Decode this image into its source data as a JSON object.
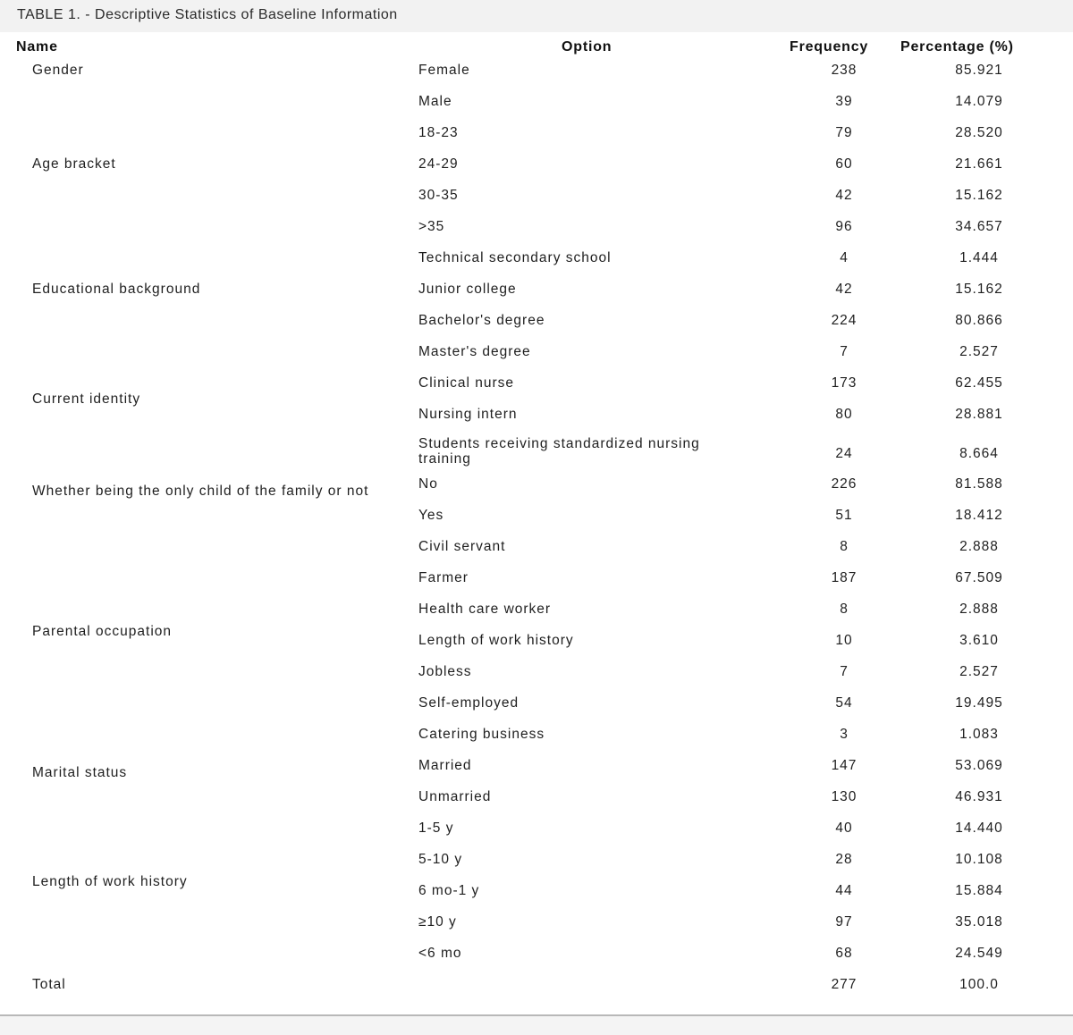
{
  "title": "TABLE 1. - Descriptive Statistics of Baseline Information",
  "headers": {
    "name": "Name",
    "option": "Option",
    "frequency": "Frequency",
    "percentage": "Percentage (%)"
  },
  "groups": [
    {
      "name": "Gender",
      "rows": [
        {
          "option": "Female",
          "frequency": "238",
          "percentage": "85.921"
        },
        {
          "option": "Male",
          "frequency": "39",
          "percentage": "14.079"
        }
      ]
    },
    {
      "name": "Age bracket",
      "rows": [
        {
          "option": "18-23",
          "frequency": "79",
          "percentage": "28.520"
        },
        {
          "option": "24-29",
          "frequency": "60",
          "percentage": "21.661"
        },
        {
          "option": "30-35",
          "frequency": "42",
          "percentage": "15.162"
        },
        {
          "option": ">35",
          "frequency": "96",
          "percentage": "34.657"
        }
      ]
    },
    {
      "name": "Educational background",
      "rows": [
        {
          "option": "Technical secondary school",
          "frequency": "4",
          "percentage": "1.444"
        },
        {
          "option": "Junior college",
          "frequency": "42",
          "percentage": "15.162"
        },
        {
          "option": "Bachelor's degree",
          "frequency": "224",
          "percentage": "80.866"
        },
        {
          "option": "Master's degree",
          "frequency": "7",
          "percentage": "2.527"
        }
      ]
    },
    {
      "name": "Current identity",
      "rows": [
        {
          "option": "Clinical nurse",
          "frequency": "173",
          "percentage": "62.455"
        },
        {
          "option": "Nursing intern",
          "frequency": "80",
          "percentage": "28.881"
        },
        {
          "option": "Students receiving standardized nursing training",
          "frequency": "24",
          "percentage": "8.664"
        }
      ]
    },
    {
      "name": "Whether being the only child of the family or not",
      "rows": [
        {
          "option": "No",
          "frequency": "226",
          "percentage": "81.588"
        },
        {
          "option": "Yes",
          "frequency": "51",
          "percentage": "18.412"
        }
      ]
    },
    {
      "name": "Parental occupation",
      "rows": [
        {
          "option": "Civil servant",
          "frequency": "8",
          "percentage": "2.888"
        },
        {
          "option": "Farmer",
          "frequency": "187",
          "percentage": "67.509"
        },
        {
          "option": "Health care worker",
          "frequency": "8",
          "percentage": "2.888"
        },
        {
          "option": "Length of work history",
          "frequency": "10",
          "percentage": "3.610"
        },
        {
          "option": "Jobless",
          "frequency": "7",
          "percentage": "2.527"
        },
        {
          "option": "Self-employed",
          "frequency": "54",
          "percentage": "19.495"
        },
        {
          "option": "Catering business",
          "frequency": "3",
          "percentage": "1.083"
        }
      ]
    },
    {
      "name": "Marital status",
      "rows": [
        {
          "option": "Married",
          "frequency": "147",
          "percentage": "53.069"
        },
        {
          "option": "Unmarried",
          "frequency": "130",
          "percentage": "46.931"
        }
      ]
    },
    {
      "name": "Length of work history",
      "rows": [
        {
          "option": "1-5 y",
          "frequency": "40",
          "percentage": "14.440"
        },
        {
          "option": "5-10 y",
          "frequency": "28",
          "percentage": "10.108"
        },
        {
          "option": "6 mo-1 y",
          "frequency": "44",
          "percentage": "15.884"
        },
        {
          "option": "≥10 y",
          "frequency": "97",
          "percentage": "35.018"
        },
        {
          "option": "<6 mo",
          "frequency": "68",
          "percentage": "24.549"
        }
      ]
    }
  ],
  "total": {
    "name": "Total",
    "frequency": "277",
    "percentage": "100.0"
  }
}
